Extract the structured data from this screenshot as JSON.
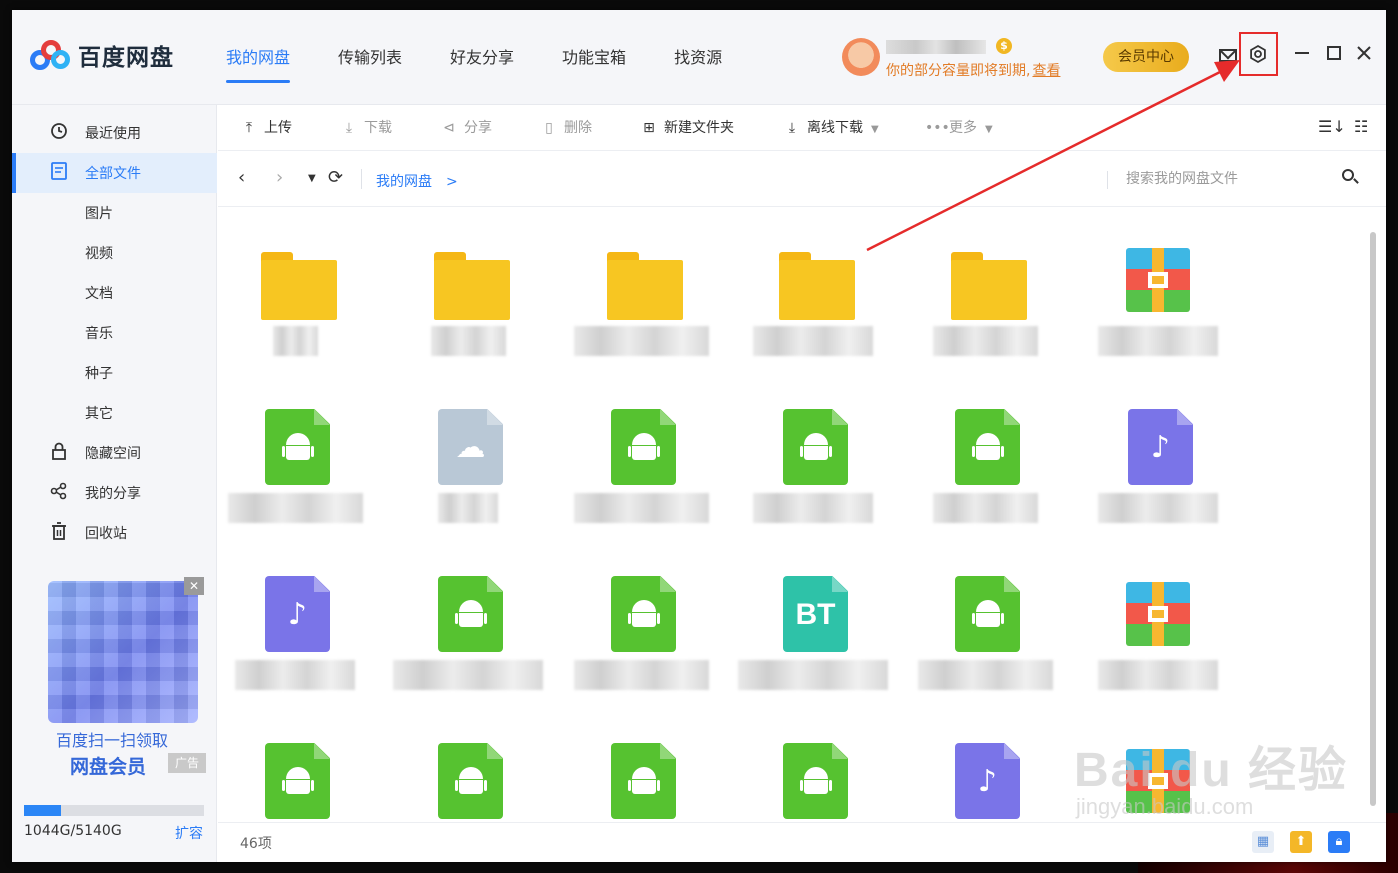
{
  "app": {
    "name": "百度网盘",
    "nav_tabs": [
      "我的网盘",
      "传输列表",
      "好友分享",
      "功能宝箱",
      "找资源"
    ],
    "active_tab": "我的网盘"
  },
  "user": {
    "capacity_notice": "你的部分容量即将到期,",
    "capacity_link": "查看",
    "vip_badge": "$"
  },
  "header": {
    "vip_button": "会员中心"
  },
  "sidebar": {
    "items": [
      {
        "label": "最近使用",
        "icon": "clock-icon"
      },
      {
        "label": "全部文件",
        "icon": "document-icon"
      },
      {
        "label": "图片",
        "icon": ""
      },
      {
        "label": "视频",
        "icon": ""
      },
      {
        "label": "文档",
        "icon": ""
      },
      {
        "label": "音乐",
        "icon": ""
      },
      {
        "label": "种子",
        "icon": ""
      },
      {
        "label": "其它",
        "icon": ""
      },
      {
        "label": "隐藏空间",
        "icon": "lock-icon"
      },
      {
        "label": "我的分享",
        "icon": "share-icon"
      },
      {
        "label": "回收站",
        "icon": "trash-icon"
      }
    ],
    "ad": {
      "line1": "百度扫一扫领取",
      "line2": "网盘会员",
      "tag": "广告"
    },
    "quota": {
      "text": "1044G/5140G",
      "used_fraction": 0.203,
      "expand": "扩容"
    }
  },
  "toolbar": {
    "upload": "上传",
    "download": "下载",
    "share": "分享",
    "delete": "删除",
    "new_folder": "新建文件夹",
    "offline_download": "离线下载",
    "more": "更多"
  },
  "address": {
    "crumb": "我的网盘",
    "crumb_sep": ">",
    "search_placeholder": "搜索我的网盘文件"
  },
  "files": [
    {
      "type": "folder"
    },
    {
      "type": "folder"
    },
    {
      "type": "folder"
    },
    {
      "type": "folder"
    },
    {
      "type": "folder"
    },
    {
      "type": "zip"
    },
    {
      "type": "apk"
    },
    {
      "type": "cloud"
    },
    {
      "type": "apk"
    },
    {
      "type": "apk"
    },
    {
      "type": "apk"
    },
    {
      "type": "music"
    },
    {
      "type": "music"
    },
    {
      "type": "apk"
    },
    {
      "type": "apk"
    },
    {
      "type": "bt",
      "glyph": "BT"
    },
    {
      "type": "apk"
    },
    {
      "type": "zip"
    },
    {
      "type": "apk"
    },
    {
      "type": "apk"
    },
    {
      "type": "apk"
    },
    {
      "type": "apk"
    },
    {
      "type": "music"
    },
    {
      "type": "zip"
    }
  ],
  "status": {
    "count": "46项"
  },
  "watermark": {
    "main": "Bai du 经验",
    "sub": "jingyan.baidu.com"
  },
  "colors": {
    "accent": "#2b7cf6",
    "highlight_box": "#e52b2b",
    "arrow": "#e52b2b",
    "notice": "#e27c27"
  }
}
